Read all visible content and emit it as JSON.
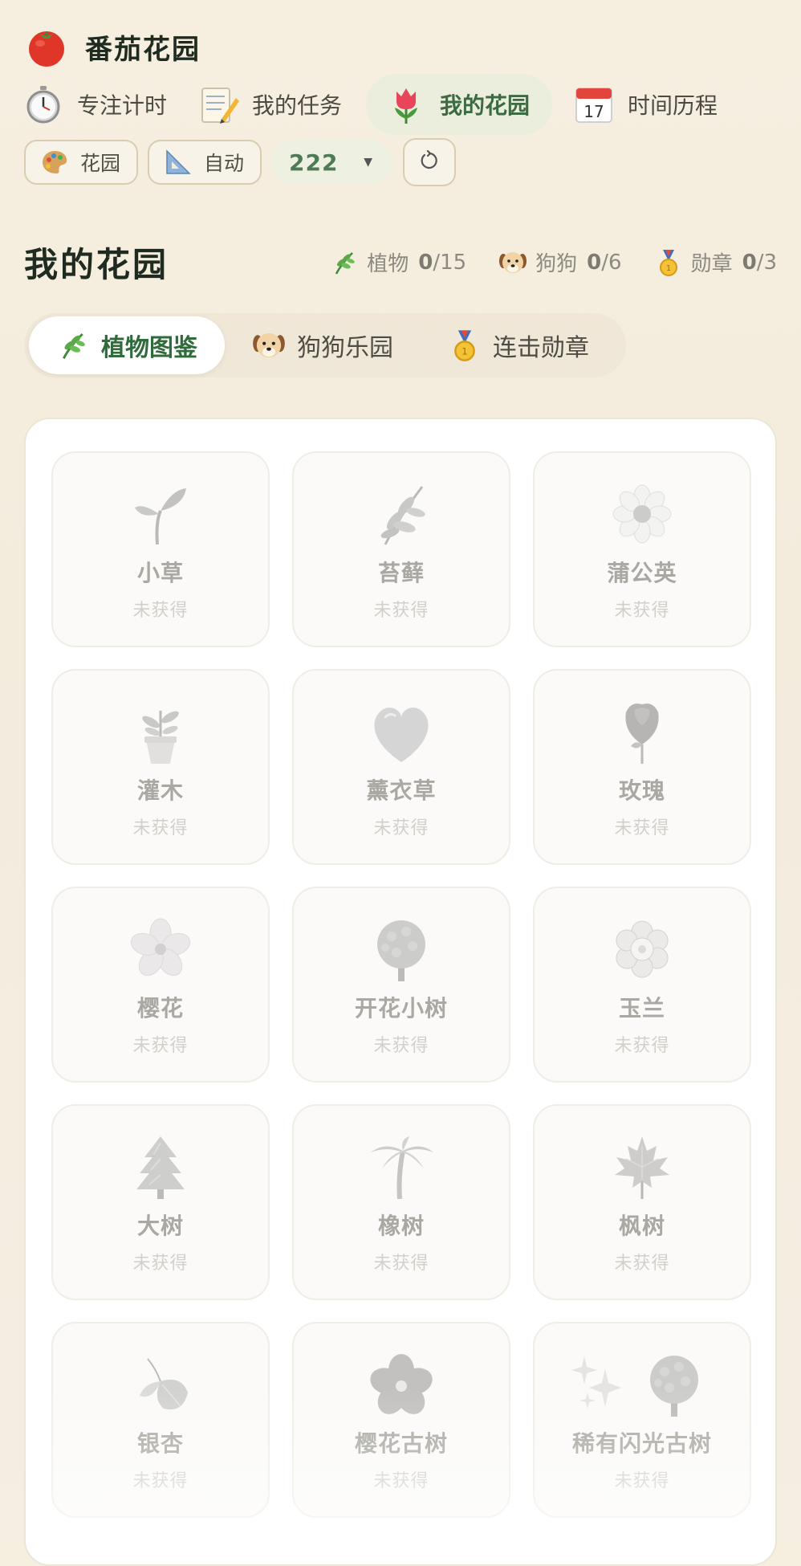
{
  "app": {
    "title": "番茄花园",
    "icon": "tomato-icon"
  },
  "nav": {
    "tabs": [
      {
        "label": "专注计时",
        "icon": "stopwatch-icon",
        "active": false
      },
      {
        "label": "我的任务",
        "icon": "memo-icon",
        "active": false
      },
      {
        "label": "我的花园",
        "icon": "tulip-icon",
        "active": true
      },
      {
        "label": "时间历程",
        "icon": "calendar-icon",
        "active": false
      }
    ]
  },
  "toolbar": {
    "garden_label": "花园",
    "auto_label": "自动",
    "select_value": "222",
    "refresh_icon": "refresh-icon"
  },
  "section": {
    "title": "我的花园"
  },
  "stats": {
    "plants": {
      "label": "植物",
      "count": "0",
      "total": "/15"
    },
    "dogs": {
      "label": "狗狗",
      "count": "0",
      "total": "/6"
    },
    "medals": {
      "label": "勋章",
      "count": "0",
      "total": "/3"
    }
  },
  "segments": {
    "tabs": [
      {
        "label": "植物图鉴",
        "icon": "herb-icon",
        "active": true
      },
      {
        "label": "狗狗乐园",
        "icon": "dog-icon",
        "active": false
      },
      {
        "label": "连击勋章",
        "icon": "medal-icon",
        "active": false
      }
    ]
  },
  "plants": {
    "status_text": "未获得",
    "items": [
      {
        "name": "小草",
        "icon": "seedling-icon",
        "status": "未获得"
      },
      {
        "name": "苔藓",
        "icon": "herb-icon",
        "status": "未获得"
      },
      {
        "name": "蒲公英",
        "icon": "blossom-icon",
        "status": "未获得"
      },
      {
        "name": "灌木",
        "icon": "potted-plant-icon",
        "status": "未获得"
      },
      {
        "name": "薰衣草",
        "icon": "heart-icon",
        "status": "未获得"
      },
      {
        "name": "玫瑰",
        "icon": "rose-icon",
        "status": "未获得"
      },
      {
        "name": "樱花",
        "icon": "cherry-blossom-icon",
        "status": "未获得"
      },
      {
        "name": "开花小树",
        "icon": "round-tree-icon",
        "status": "未获得"
      },
      {
        "name": "玉兰",
        "icon": "rosette-icon",
        "status": "未获得"
      },
      {
        "name": "大树",
        "icon": "evergreen-tree-icon",
        "status": "未获得"
      },
      {
        "name": "橡树",
        "icon": "palm-tree-icon",
        "status": "未获得"
      },
      {
        "name": "枫树",
        "icon": "maple-leaf-icon",
        "status": "未获得"
      },
      {
        "name": "银杏",
        "icon": "leaves-icon",
        "status": "未获得"
      },
      {
        "name": "樱花古树",
        "icon": "hibiscus-icon",
        "status": "未获得"
      },
      {
        "name": "稀有闪光古树",
        "icon": "sparkles-tree-icon",
        "status": "未获得"
      }
    ]
  },
  "colors": {
    "accent_green": "#3c6a43",
    "background": "#f6efe0",
    "card_border": "#f0ede6"
  }
}
